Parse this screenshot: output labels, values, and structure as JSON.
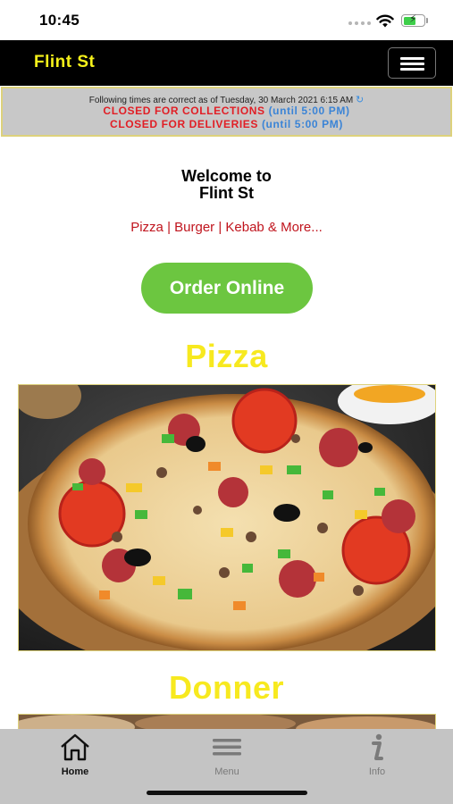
{
  "status_bar": {
    "time": "10:45"
  },
  "navbar": {
    "brand": "Flint St"
  },
  "notice": {
    "timestamp_text": "Following times are correct as of Tuesday, 30 March 2021 6:15 AM",
    "collections_status": "CLOSED FOR COLLECTIONS",
    "collections_open": "(until 5:00 PM)",
    "deliveries_status": "CLOSED FOR DELIVERIES",
    "deliveries_open": "(until 5:00 PM)"
  },
  "welcome": {
    "line1": "Welcome to",
    "line2": "Flint St"
  },
  "tagline": "Pizza | Burger | Kebab & More...",
  "order_button": "Order Online",
  "sections": [
    {
      "title": "Pizza"
    },
    {
      "title": "Donner"
    }
  ],
  "tab_bar": {
    "tabs": [
      {
        "label": "Home",
        "icon": "home-icon",
        "active": true
      },
      {
        "label": "Menu",
        "icon": "menu-icon",
        "active": false
      },
      {
        "label": "Info",
        "icon": "info-icon",
        "active": false
      }
    ]
  },
  "colors": {
    "brand_yellow": "#f5f11a",
    "section_yellow": "#f7e91f",
    "order_green": "#6cc640",
    "closed_red": "#e11e25",
    "until_blue": "#3b84d6",
    "tagline_red": "#c0141d"
  }
}
